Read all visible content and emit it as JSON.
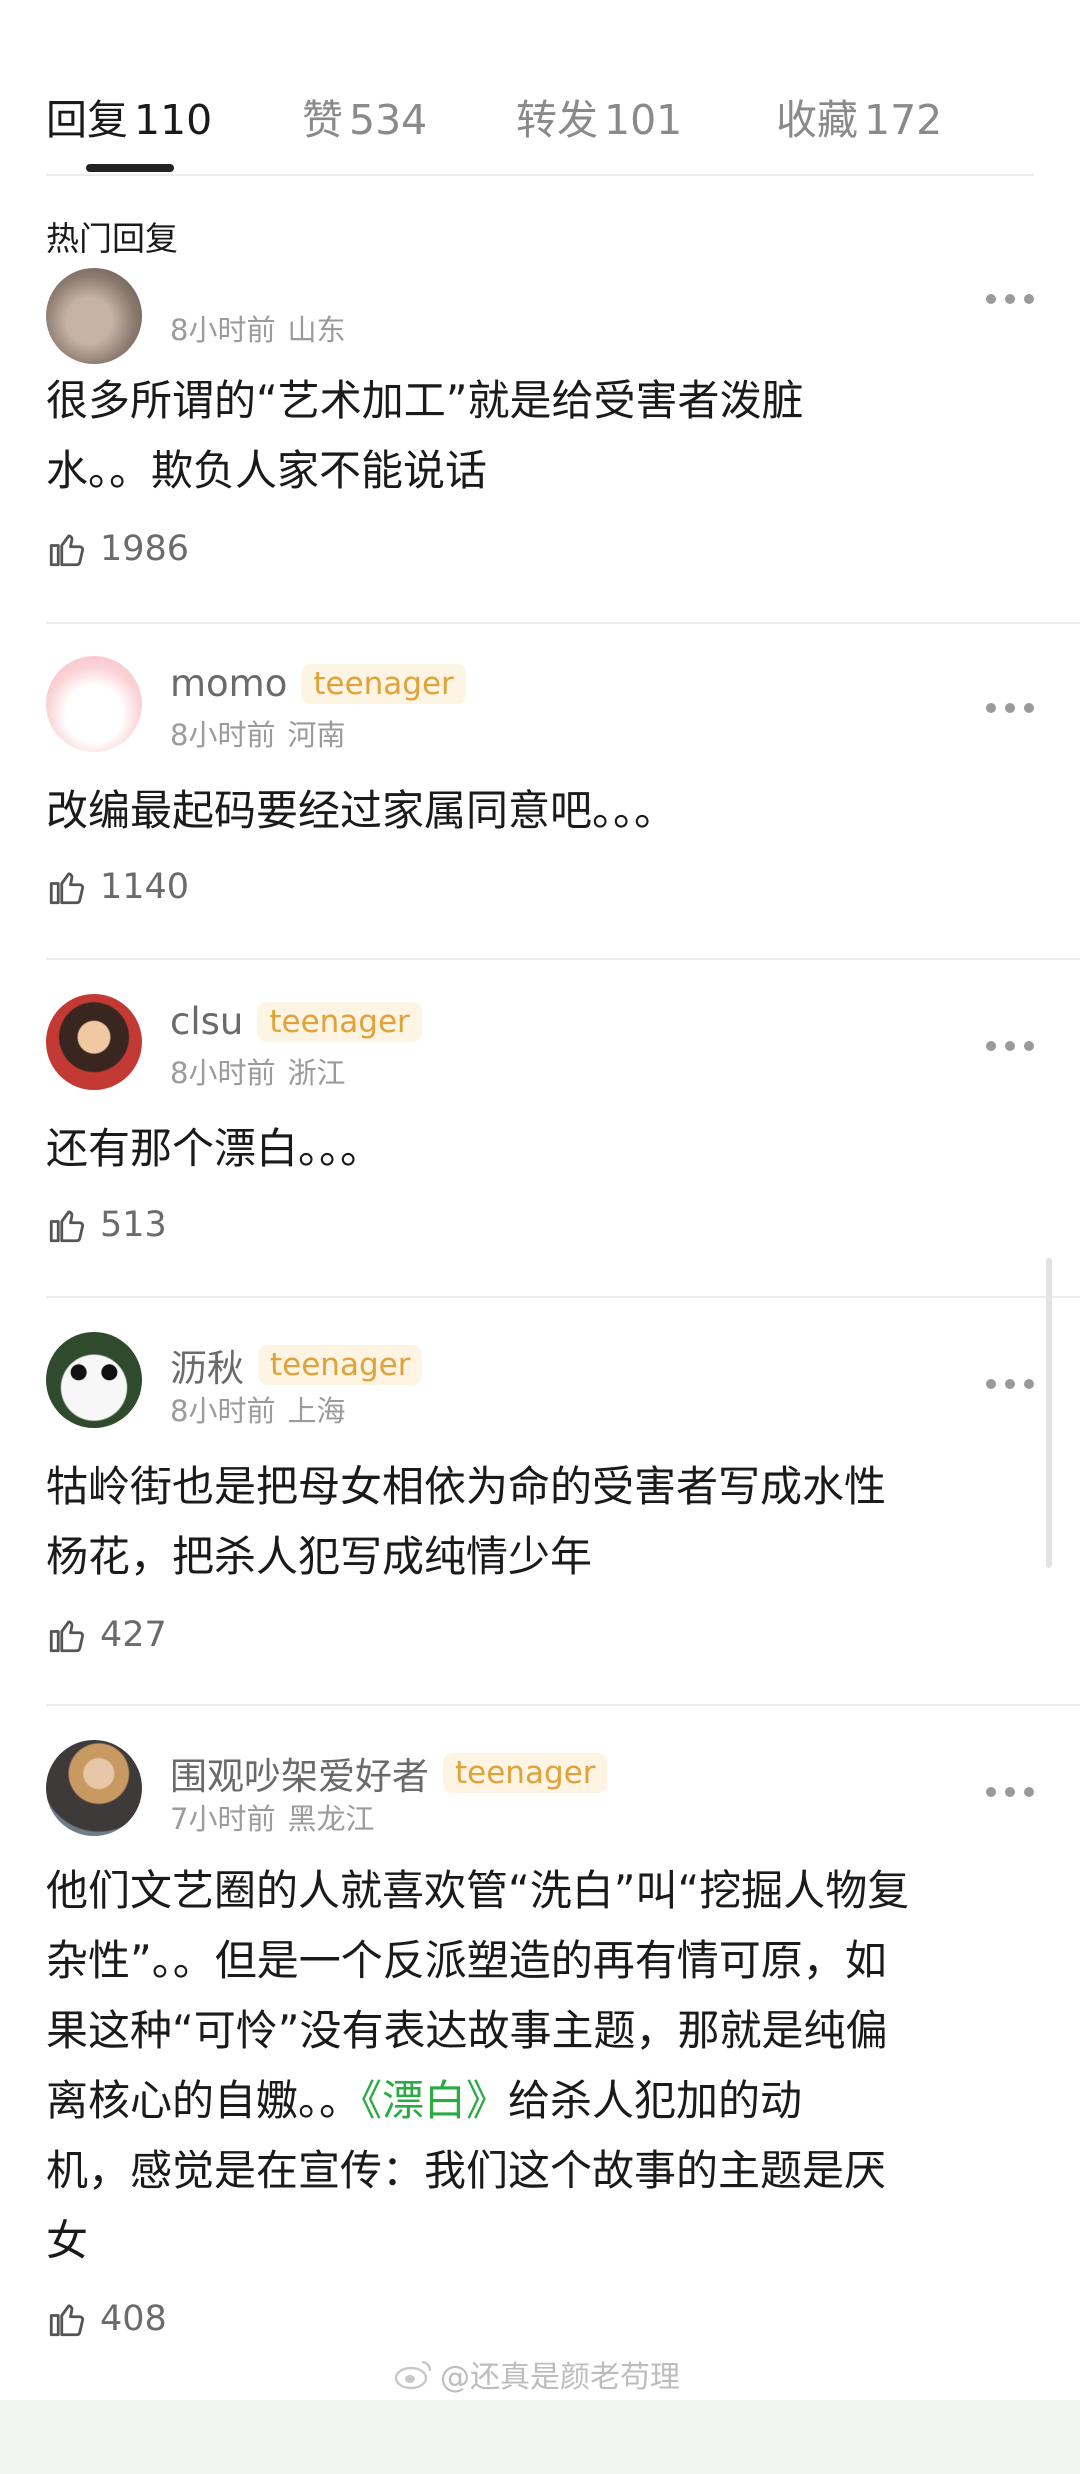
{
  "tabs": [
    {
      "label": "回复",
      "count": "110"
    },
    {
      "label": "赞",
      "count": "534"
    },
    {
      "label": "转发",
      "count": "101"
    },
    {
      "label": "收藏",
      "count": "172"
    }
  ],
  "section_title": "热门回复",
  "comments": [
    {
      "username": "",
      "badge": "",
      "time": "8小时前",
      "location": "山东",
      "content": "很多所谓的“艺术加工”就是给受害者泼脏\n水。。欺负人家不能说话",
      "likes": "1986"
    },
    {
      "username": "momo",
      "badge": "teenager",
      "time": "8小时前",
      "location": "河南",
      "content": "改编最起码要经过家属同意吧。。。",
      "likes": "1140"
    },
    {
      "username": "clsu",
      "badge": "teenager",
      "time": "8小时前",
      "location": "浙江",
      "content": "还有那个漂白。。。",
      "likes": "513"
    },
    {
      "username": "沥秋",
      "badge": "teenager",
      "time": "8小时前",
      "location": "上海",
      "content": "牯岭街也是把母女相依为命的受害者写成水性\n杨花，把杀人犯写成纯情少年",
      "likes": "427"
    },
    {
      "username": "围观吵架爱好者",
      "badge": "teenager",
      "time": "7小时前",
      "location": "黑龙江",
      "content_before": "他们文艺圈的人就喜欢管“洗白”叫“挖掘人物复\n杂性”。。但是一个反派塑造的再有情可原，如\n果这种“可怜”没有表达故事主题，那就是纯偏\n离核心的自嫐。。",
      "content_link": "《漂白》",
      "content_after": "给杀人犯加的动\n机，感觉是在宣传：我们这个故事的主题是厌\n女",
      "likes": "408"
    }
  ],
  "watermark": "@还真是颜老苟理",
  "colors": {
    "badge_text": "#e1a23a",
    "badge_bg": "#fdf4e3",
    "link": "#2bab43"
  }
}
